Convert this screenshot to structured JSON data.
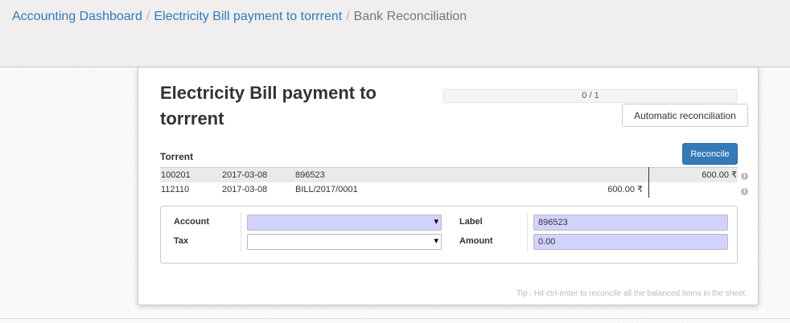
{
  "breadcrumb": {
    "items": [
      "Accounting Dashboard",
      "Electricity Bill payment to torrrent"
    ],
    "separator": "/",
    "current": "Bank Reconciliation"
  },
  "reconciliation": {
    "title": "Electricity Bill payment to torrrent",
    "progress_text": "0 / 1",
    "progress_value": 0,
    "auto_button": "Automatic reconciliation",
    "partner": "Torrent",
    "reconcile_button": "Reconcile",
    "lines": [
      {
        "account": "100201",
        "date": "2017-03-08",
        "label": "896523",
        "debit": "",
        "credit": "600.00 ₹"
      },
      {
        "account": "112110",
        "date": "2017-03-08",
        "label": "BILL/2017/0001",
        "debit": "600.00 ₹",
        "credit": ""
      }
    ],
    "info_icon": "info-circle-icon"
  },
  "form": {
    "account_label": "Account",
    "account_value": "",
    "tax_label": "Tax",
    "tax_value": "",
    "label_label": "Label",
    "label_value": "896523",
    "amount_label": "Amount",
    "amount_value": "0.00",
    "caret_glyph": "▾"
  },
  "tip": "Tip : Hit ctrl-enter to reconcile all the balanced items in the sheet.",
  "colors": {
    "link": "#337ab7",
    "primary": "#337ab7",
    "required_field": "#d2d2ff"
  }
}
